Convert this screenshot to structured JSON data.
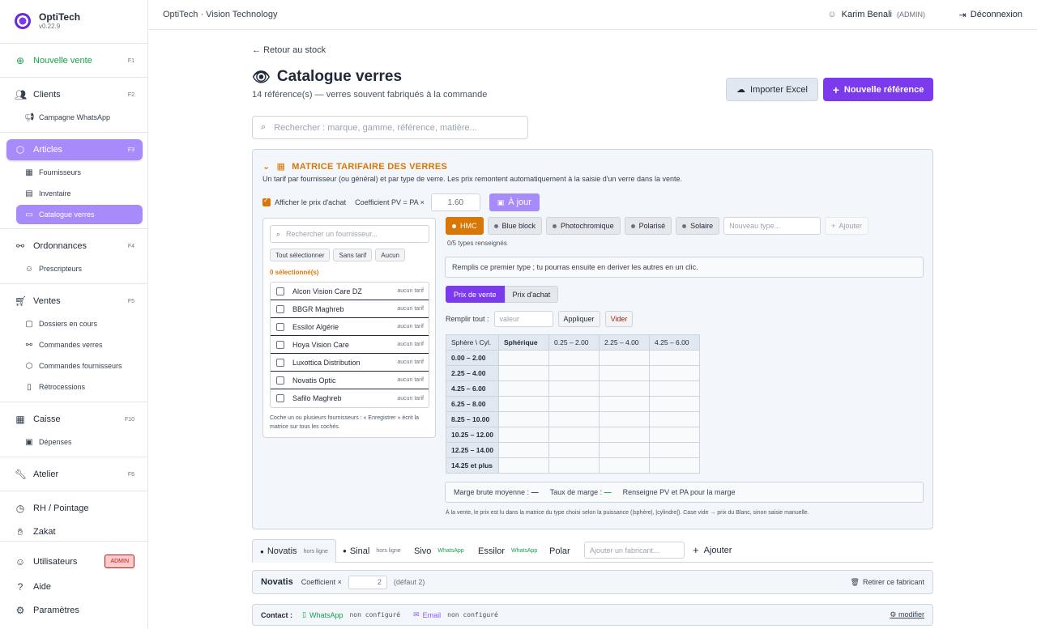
{
  "app": {
    "name": "OptiTech",
    "version": "v0.22.9"
  },
  "topbar": {
    "title": "OptiTech · Vision Technology",
    "user": "Karim Benali",
    "role": "(ADMIN)",
    "logout": "Déconnexion"
  },
  "sidebar": {
    "new_sale": {
      "label": "Nouvelle vente",
      "key": "F1"
    },
    "clients": {
      "label": "Clients",
      "key": "F2"
    },
    "whatsapp": {
      "label": "Campagne WhatsApp"
    },
    "articles": {
      "label": "Articles",
      "key": "F3"
    },
    "fournisseurs": {
      "label": "Fournisseurs"
    },
    "inventaire": {
      "label": "Inventaire"
    },
    "catalogue": {
      "label": "Catalogue verres"
    },
    "ordonnances": {
      "label": "Ordonnances",
      "key": "F4"
    },
    "prescripteurs": {
      "label": "Prescripteurs"
    },
    "ventes": {
      "label": "Ventes",
      "key": "F5"
    },
    "dossiers": {
      "label": "Dossiers en cours"
    },
    "commandes_verres": {
      "label": "Commandes verres"
    },
    "commandes_fournisseurs": {
      "label": "Commandes fournisseurs"
    },
    "retrocessions": {
      "label": "Rétrocessions"
    },
    "caisse": {
      "label": "Caisse",
      "key": "F10"
    },
    "depenses": {
      "label": "Dépenses"
    },
    "atelier": {
      "label": "Atelier",
      "key": "F6"
    },
    "rh": {
      "label": "RH / Pointage"
    },
    "zakat": {
      "label": "Zakat"
    },
    "utilisateurs": {
      "label": "Utilisateurs",
      "badge": "ADMIN"
    },
    "aide": {
      "label": "Aide"
    },
    "parametres": {
      "label": "Paramètres"
    }
  },
  "page": {
    "back": "Retour au stock",
    "title": "Catalogue verres",
    "subtitle": "14 référence(s) — verres souvent fabriqués à la commande",
    "import_btn": "Importer Excel",
    "new_btn": "Nouvelle référence",
    "search_placeholder": "Rechercher : marque, gamme, référence, matière..."
  },
  "matrix": {
    "title": "MATRICE TARIFAIRE DES VERRES",
    "desc": "Un tarif par fournisseur (ou général) et par type de verre. Les prix remontent automatiquement à la saisie d'un verre dans la vente.",
    "show_purchase": "Afficher le prix d'achat",
    "coef_label": "Coefficient PV = PA ×",
    "coef_value": "1.60",
    "update_btn": "À jour",
    "supplier_search": "Rechercher un fournisseur...",
    "btn_all": "Tout sélectionner",
    "btn_no_tarif": "Sans tarif",
    "btn_none": "Aucun",
    "selected_count": "0 sélectionné(s)",
    "suppliers": [
      {
        "name": "Alcon Vision Care DZ",
        "tag": "aucun tarif"
      },
      {
        "name": "BBGR Maghreb",
        "tag": "aucun tarif"
      },
      {
        "name": "Essilor Algérie",
        "tag": "aucun tarif"
      },
      {
        "name": "Hoya Vision Care",
        "tag": "aucun tarif"
      },
      {
        "name": "Luxottica Distribution",
        "tag": "aucun tarif"
      },
      {
        "name": "Novatis Optic",
        "tag": "aucun tarif"
      },
      {
        "name": "Safilo Maghreb",
        "tag": "aucun tarif"
      }
    ],
    "supplier_note": "Coche un ou plusieurs fournisseurs : « Enregistrer » écrit la matrice sur tous les cochés.",
    "types": [
      "HMC",
      "Blue block",
      "Photochromique",
      "Polarisé",
      "Solaire"
    ],
    "new_type_placeholder": "Nouveau type...",
    "add_type": "Ajouter",
    "types_count": "0/5 types renseignés",
    "hint": "Remplis ce premier type ; tu pourras ensuite en deriver les autres en un clic.",
    "seg_sale": "Prix de vente",
    "seg_purchase": "Prix d'achat",
    "fill_label": "Remplir tout :",
    "fill_placeholder": "valeur",
    "apply": "Appliquer",
    "clear": "Vider",
    "grid_corner": "Sphère \\ Cyl.",
    "grid_cols": [
      "Sphérique",
      "0.25 – 2.00",
      "2.25 – 4.00",
      "4.25 – 6.00"
    ],
    "grid_rows": [
      "0.00 – 2.00",
      "2.25 – 4.00",
      "4.25 – 6.00",
      "6.25 – 8.00",
      "8.25 – 10.00",
      "10.25 – 12.00",
      "12.25 – 14.00",
      "14.25 et plus"
    ],
    "margin_label": "Marge brute moyenne :",
    "margin_value": "—",
    "rate_label": "Taux de marge :",
    "rate_value": "—",
    "margin_hint": "Renseigne PV et PA pour la marge",
    "footnote": "À la vente, le prix est lu dans la matrice du type choisi selon la puissance (|sphère|, |cylindre|). Case vide → prix du Blanc, sinon saisie manuelle."
  },
  "brands": {
    "tabs": [
      {
        "name": "Novatis",
        "badge": "hors ligne"
      },
      {
        "name": "Sinal",
        "badge": "hors ligne"
      },
      {
        "name": "Sivo",
        "wa": "WhatsApp"
      },
      {
        "name": "Essilor",
        "wa": "WhatsApp"
      },
      {
        "name": "Polar"
      }
    ],
    "add_placeholder": "Ajouter un fabricant...",
    "add_btn": "Ajouter",
    "current": "Novatis",
    "coef_label": "Coefficient ×",
    "coef_value": "2",
    "coef_default": "(défaut 2)",
    "remove": "Retirer ce fabricant",
    "contact_label": "Contact :",
    "whatsapp": "WhatsApp",
    "whatsapp_status": "non configuré",
    "email": "Email",
    "email_status": "non configuré",
    "modify": "modifier"
  }
}
